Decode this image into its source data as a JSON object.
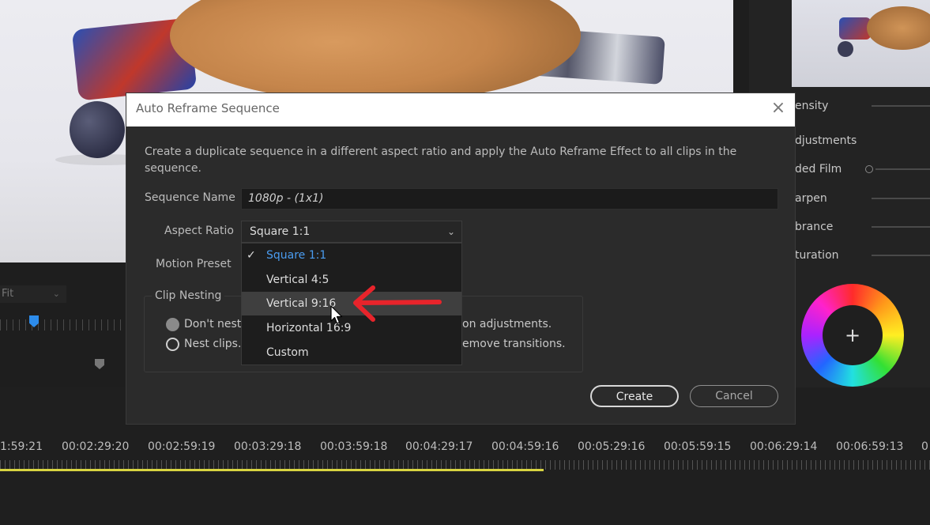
{
  "dialog": {
    "title": "Auto Reframe Sequence",
    "close_icon": "close-icon",
    "description": "Create a duplicate sequence in a different aspect ratio and apply the Auto Reframe Effect to all clips in the sequence.",
    "sequence_name_label": "Sequence Name",
    "sequence_name_value": "1080p - (1x1)",
    "aspect_ratio_label": "Aspect Ratio",
    "aspect_ratio_value": "Square 1:1",
    "motion_preset_label": "Motion Preset",
    "clip_nesting_label": "Clip Nesting",
    "radio_1_text_start": "Don't nest",
    "radio_1_text_end": "on adjustments.",
    "radio_2_text_start": "Nest clips.",
    "radio_2_text_end": "emove transitions.",
    "create_label": "Create",
    "cancel_label": "Cancel",
    "aspect_ratio_options": [
      "Square 1:1",
      "Vertical 4:5",
      "Vertical 9:16",
      "Horizontal 16:9",
      "Custom"
    ],
    "selected_option": "Square 1:1",
    "hovered_option": "Vertical 9:16"
  },
  "monitor": {
    "fit_label": "Fit"
  },
  "lumetri": {
    "labels": [
      "ensity",
      "djustments",
      "ded Film",
      "arpen",
      "brance",
      "turation"
    ],
    "wheel_symbol": "+"
  },
  "timeline": {
    "timecodes": [
      "1:59:21",
      "00:02:29:20",
      "00:02:59:19",
      "00:03:29:18",
      "00:03:59:18",
      "00:04:29:17",
      "00:04:59:16",
      "00:05:29:16",
      "00:05:59:15",
      "00:06:29:14",
      "00:06:59:13",
      "0"
    ]
  },
  "colors": {
    "accent_blue": "#4a9cf0",
    "annotation_red": "#e8242b",
    "work_area_yellow": "#d7d441"
  }
}
